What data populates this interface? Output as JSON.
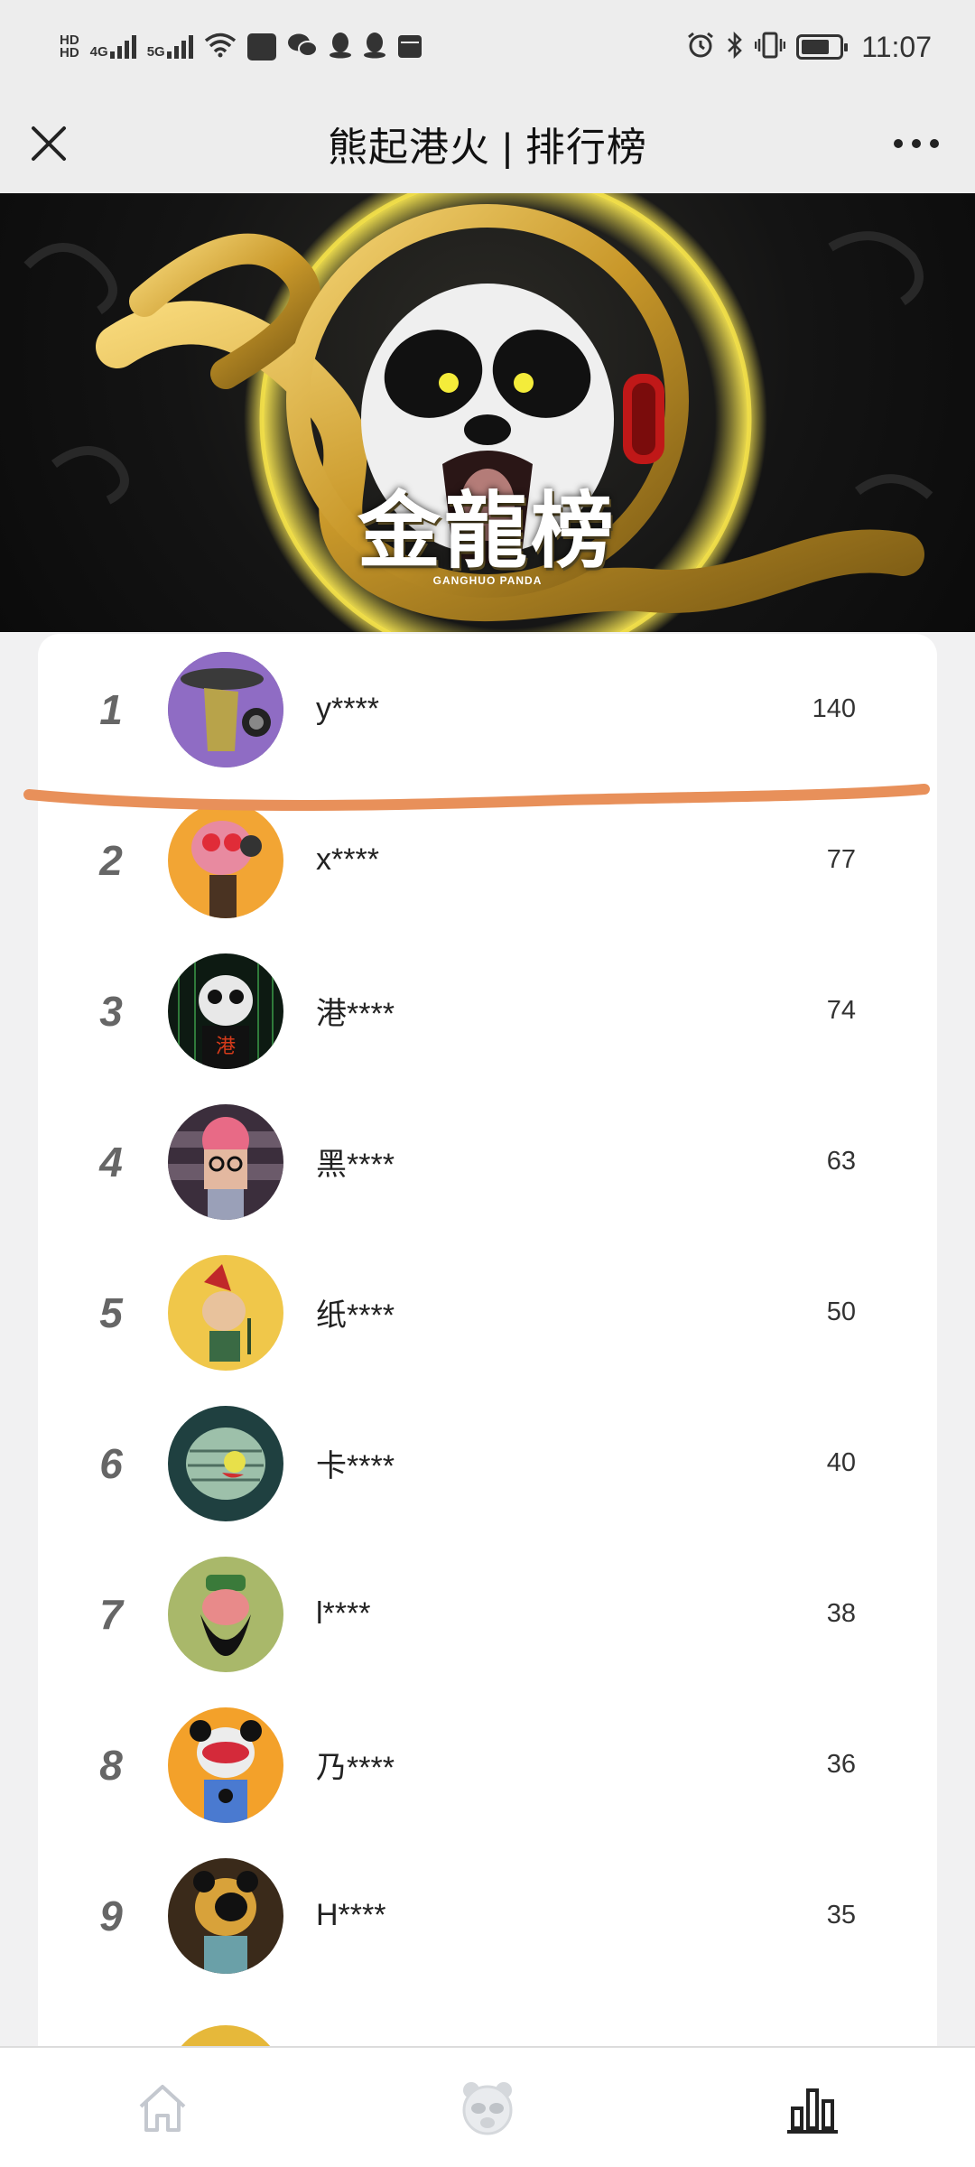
{
  "status_bar": {
    "time": "11:07",
    "net_left": "HD",
    "net_4g": "4G",
    "net_5g": "5G",
    "icons": [
      "hd-icon",
      "signal-4g-icon",
      "signal-5g-icon",
      "wifi-icon",
      "wallet-icon",
      "wechat-icon",
      "qq-icon",
      "qq-icon",
      "calendar-icon",
      "alarm-icon",
      "bluetooth-icon",
      "vibrate-icon",
      "battery-icon"
    ]
  },
  "header": {
    "title": "熊起港火 | 排行榜",
    "close_icon": "close-icon",
    "more_icon": "more-icon"
  },
  "banner": {
    "title": "金龍榜",
    "subtitle": "GANGHUO PANDA"
  },
  "ranking": [
    {
      "rank": "1",
      "name": "y****",
      "score": "140"
    },
    {
      "rank": "2",
      "name": "x****",
      "score": "77"
    },
    {
      "rank": "3",
      "name": "港****",
      "score": "74"
    },
    {
      "rank": "4",
      "name": "黑****",
      "score": "63"
    },
    {
      "rank": "5",
      "name": "纸****",
      "score": "50"
    },
    {
      "rank": "6",
      "name": "卡****",
      "score": "40"
    },
    {
      "rank": "7",
      "name": "l****",
      "score": "38"
    },
    {
      "rank": "8",
      "name": "乃****",
      "score": "36"
    },
    {
      "rank": "9",
      "name": "H****",
      "score": "35"
    }
  ],
  "bottom_nav": [
    {
      "icon": "home-icon"
    },
    {
      "icon": "panda-icon"
    },
    {
      "icon": "ranking-icon"
    }
  ],
  "colors": {
    "highlight_stroke": "#e8905a",
    "banner_gold": "#d4a52c",
    "card_bg": "#ffffff",
    "page_bg": "#f1f1f2"
  }
}
